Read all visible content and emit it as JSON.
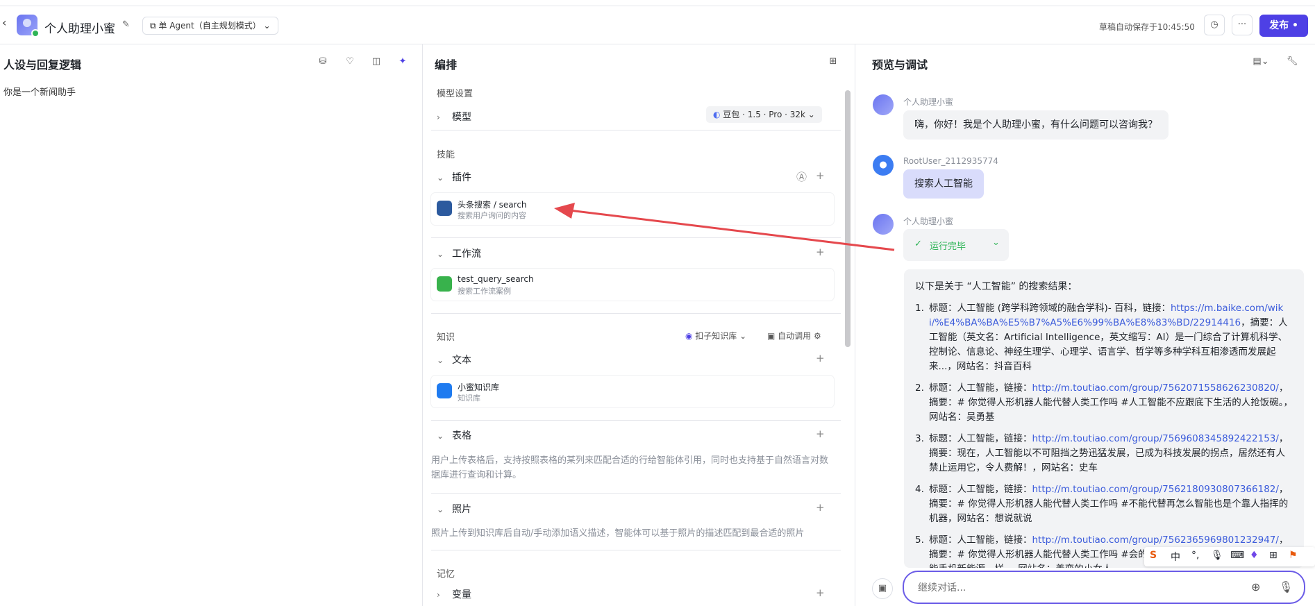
{
  "header": {
    "back_icon": "‹",
    "app_title": "个人助理小蜜",
    "mode_label": "单 Agent（自主规划模式）",
    "autosave_text": "草稿自动保存于10:45:50",
    "history_icon": "◷",
    "more_icon": "···",
    "publish_label": "发布"
  },
  "left": {
    "title": "人设与回复逻辑",
    "content": "你是一个新闻助手"
  },
  "mid": {
    "title": "编排",
    "model_section": "模型设置",
    "model_label": "模型",
    "model_value": "豆包 · 1.5 · Pro · 32k",
    "skills_section": "技能",
    "plugins_label": "插件",
    "plugin_card": {
      "name": "头条搜索 / search",
      "desc": "搜索用户询问的内容"
    },
    "workflow_label": "工作流",
    "workflow_card": {
      "name": "test_query_search",
      "desc": "搜索工作流案例"
    },
    "knowledge_section": "知识",
    "kb_selector": "扣子知识库",
    "auto_call": "自动调用",
    "text_label": "文本",
    "text_card": {
      "name": "小蜜知识库",
      "desc": "知识库"
    },
    "table_label": "表格",
    "table_desc": "用户上传表格后，支持按照表格的某列来匹配合适的行给智能体引用，同时也支持基于自然语言对数据库进行查询和计算。",
    "photo_label": "照片",
    "photo_desc": "照片上传到知识库后自动/手动添加语义描述，智能体可以基于照片的描述匹配到最合适的照片",
    "memory_section": "记忆",
    "variable_label": "变量"
  },
  "right": {
    "title": "预览与调试",
    "bot_name": "个人助理小蜜",
    "greeting": "嗨，你好！我是个人助理小蜜，有什么问题可以咨询我？",
    "user_name": "RootUser_2112935774",
    "user_msg": "搜索人工智能",
    "bot_name2": "个人助理小蜜",
    "status": "运行完毕",
    "answer_intro": "以下是关于 “人工智能” 的搜索结果：",
    "results": [
      {
        "num": "1.",
        "pre": "标题：人工智能 (跨学科跨领域的融合学科)- 百科，链接：",
        "link": "https://m.baike.com/wiki/%E4%BA%BA%E5%B7%A5%E6%99%BA%E8%83%BD/22914416",
        "post": "，摘要：人工智能（英文名：Artificial Intelligence，英文缩写：AI）是一门综合了计算机科学、控制论、信息论、神经生理学、心理学、语言学、哲学等多种学科互相渗透而发展起来...，网站名：抖音百科"
      },
      {
        "num": "2.",
        "pre": "标题：人工智能，链接：",
        "link": "http://m.toutiao.com/group/7562071558626230820/",
        "post": "，摘要：# 你觉得人形机器人能代替人类工作吗 #人工智能不应跟底下生活的人抢饭碗。，网站名：吴勇基"
      },
      {
        "num": "3.",
        "pre": "标题：人工智能，链接：",
        "link": "http://m.toutiao.com/group/7569608345892422153/",
        "post": "，摘要：现在，人工智能以不可阻挡之势迅猛发展，已成为科技发展的拐点，居然还有人禁止运用它，令人费解！，网站名：史车"
      },
      {
        "num": "4.",
        "pre": "标题：人工智能，链接：",
        "link": "http://m.toutiao.com/group/7562180930807366182/",
        "post": "，摘要：# 你觉得人形机器人能代替人类工作吗 #不能代替再怎么智能也是个靠人指挥的机器，网站名：想说就说"
      },
      {
        "num": "5.",
        "pre": "标题：人工智能，链接：",
        "link": "http://m.toutiao.com/group/7562365969801232947/",
        "post": "，摘要：# 你觉得人形机器人能代替人类工作吗 #会的会的，就像当初智能手机替代了功能手机新能源一样。，网站名：善变的小女人"
      }
    ],
    "input_placeholder": "继续对话..."
  },
  "ime": {
    "zh": "中"
  },
  "colors": {
    "accent": "#4e40e5",
    "link": "#3b5bdb",
    "success": "#2fb457",
    "arrow": "#e5484d"
  }
}
